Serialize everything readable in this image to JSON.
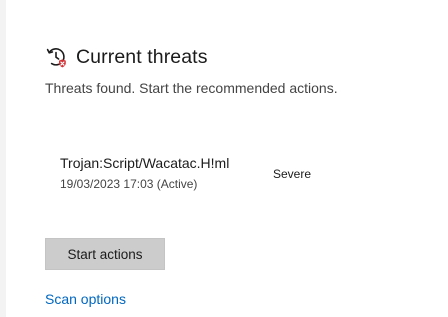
{
  "section": {
    "icon": "clock-shield-icon",
    "title": "Current threats",
    "description": "Threats found. Start the recommended actions."
  },
  "threats": [
    {
      "name": "Trojan:Script/Wacatac.H!ml",
      "date": "19/03/2023 17:03 (Active)",
      "severity": "Severe"
    }
  ],
  "actions": {
    "start_label": "Start actions",
    "scan_options_label": "Scan options"
  },
  "colors": {
    "link": "#0067c0",
    "button_bg": "#cccccc",
    "alert_red": "#d13438"
  }
}
